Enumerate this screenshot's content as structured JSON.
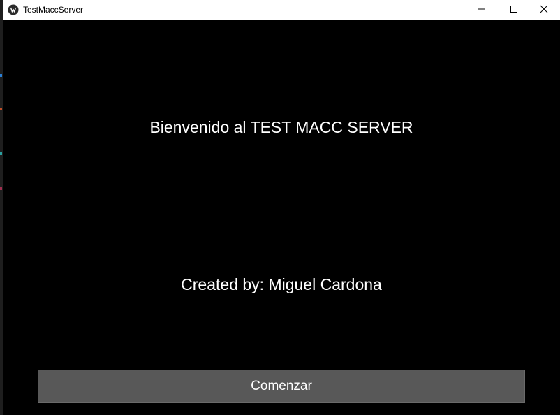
{
  "window": {
    "title": "TestMaccServer",
    "app_icon": "app-logo-icon",
    "controls": {
      "minimize_icon": "minimize-icon",
      "maximize_icon": "maximize-icon",
      "close_icon": "close-icon"
    }
  },
  "main": {
    "welcome_text": "Bienvenido al TEST MACC SERVER",
    "credits_text": "Created by: Miguel Cardona",
    "start_button_label": "Comenzar"
  },
  "colors": {
    "background": "#000000",
    "titlebar": "#ffffff",
    "text": "#ffffff",
    "button": "#585858"
  }
}
